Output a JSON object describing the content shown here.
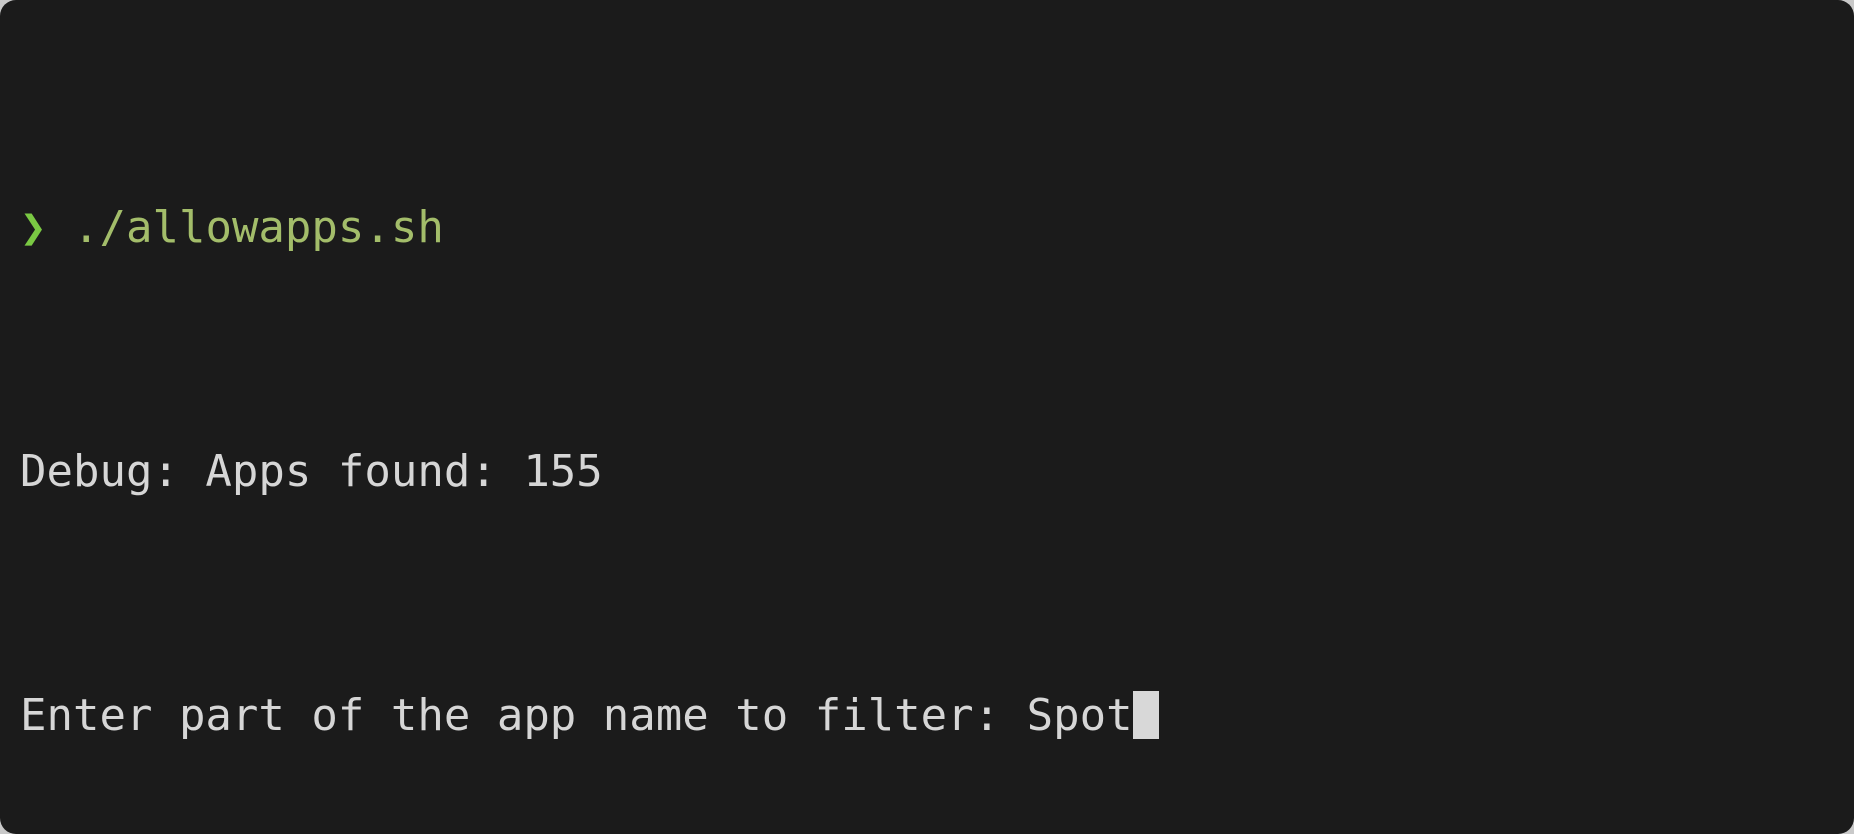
{
  "window": {
    "app": "Terminal",
    "background_color": "#1b1b1b",
    "desktop_color": "#c9c9c9",
    "corner_radius_px": 16
  },
  "theme": {
    "foreground": "#d6d6d6",
    "prompt_green": "#7ac943",
    "command_green": "#a3bd6a",
    "cursor_color": "#d8d8d8",
    "font_size_px": 44,
    "line_height_px": 61
  },
  "session": {
    "lines": [
      {
        "type": "prompt",
        "prompt_symbol": "❯",
        "command": "./allowapps.sh"
      },
      {
        "type": "output",
        "text": "Debug: Apps found: 155"
      },
      {
        "type": "input",
        "text": "Enter part of the app name to filter: ",
        "typed": "Spot",
        "cursor": true
      }
    ],
    "line1": {
      "prompt_symbol": "❯",
      "command": "./allowapps.sh"
    },
    "line2": {
      "text": "Debug: Apps found: 155",
      "label": "Debug: Apps found:",
      "count": "155"
    },
    "line3": {
      "prompt_text": "Enter part of the app name to filter: ",
      "typed_value": "Spot"
    }
  }
}
